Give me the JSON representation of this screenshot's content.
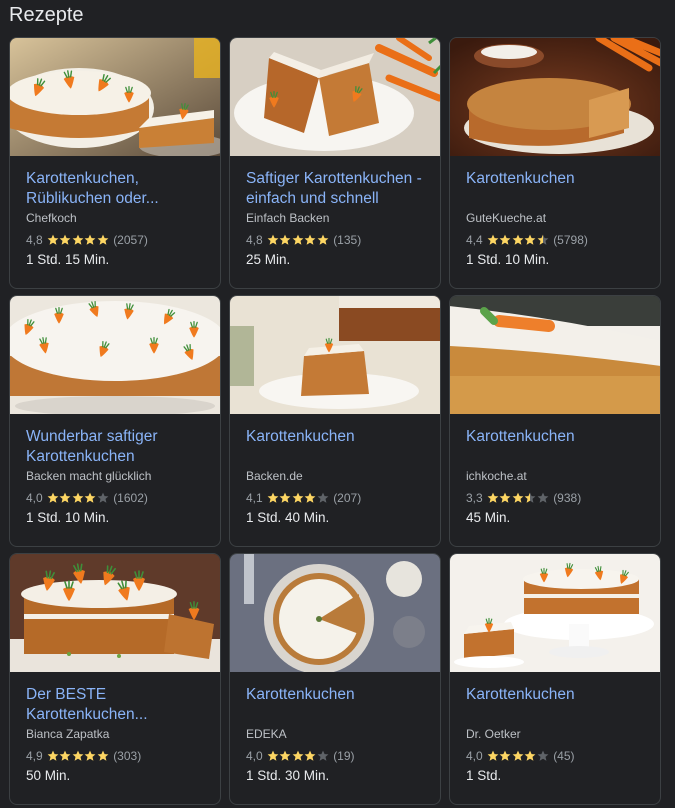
{
  "section": {
    "title": "Rezepte"
  },
  "colors": {
    "link": "#8ab4f8",
    "star": "#fdd663",
    "star_empty": "#5f6368"
  },
  "recipes": [
    {
      "title": "Karottenkuchen, Rüblikuchen oder...",
      "source": "Chefkoch",
      "rating": "4,8",
      "stars": 5,
      "count": "(2057)",
      "time": "1 Std. 15 Min.",
      "image": "carrot-cake-slice"
    },
    {
      "title": "Saftiger Karottenkuchen - einfach und schnell",
      "source": "Einfach Backen",
      "rating": "4,8",
      "stars": 5,
      "count": "(135)",
      "time": "25 Min.",
      "image": "carrot-cake-plate"
    },
    {
      "title": "Karottenkuchen",
      "source": "GuteKueche.at",
      "rating": "4,4",
      "stars": 4.5,
      "count": "(5798)",
      "time": "1 Std. 10 Min.",
      "image": "carrot-cake-round"
    },
    {
      "title": "Wunderbar saftiger Karottenkuchen",
      "source": "Backen macht glücklich",
      "rating": "4,0",
      "stars": 4,
      "count": "(1602)",
      "time": "1 Std. 10 Min.",
      "image": "carrot-cake-frosted"
    },
    {
      "title": "Karottenkuchen",
      "source": "Backen.de",
      "rating": "4,1",
      "stars": 4,
      "count": "(207)",
      "time": "1 Std. 40 Min.",
      "image": "carrot-cake-piece"
    },
    {
      "title": "Karottenkuchen",
      "source": "ichkoche.at",
      "rating": "3,3",
      "stars": 3.5,
      "count": "(938)",
      "time": "45 Min.",
      "image": "carrot-cake-closeup"
    },
    {
      "title": "Der BESTE Karottenkuchen...",
      "source": "Bianca Zapatka",
      "rating": "4,9",
      "stars": 5,
      "count": "(303)",
      "time": "50 Min.",
      "image": "carrot-cake-layered"
    },
    {
      "title": "Karottenkuchen",
      "source": "EDEKA",
      "rating": "4,0",
      "stars": 4,
      "count": "(19)",
      "time": "1 Std. 30 Min.",
      "image": "carrot-cake-topdown"
    },
    {
      "title": "Karottenkuchen",
      "source": "Dr. Oetker",
      "rating": "4,0",
      "stars": 4,
      "count": "(45)",
      "time": "1 Std.",
      "image": "carrot-cake-stand"
    }
  ]
}
